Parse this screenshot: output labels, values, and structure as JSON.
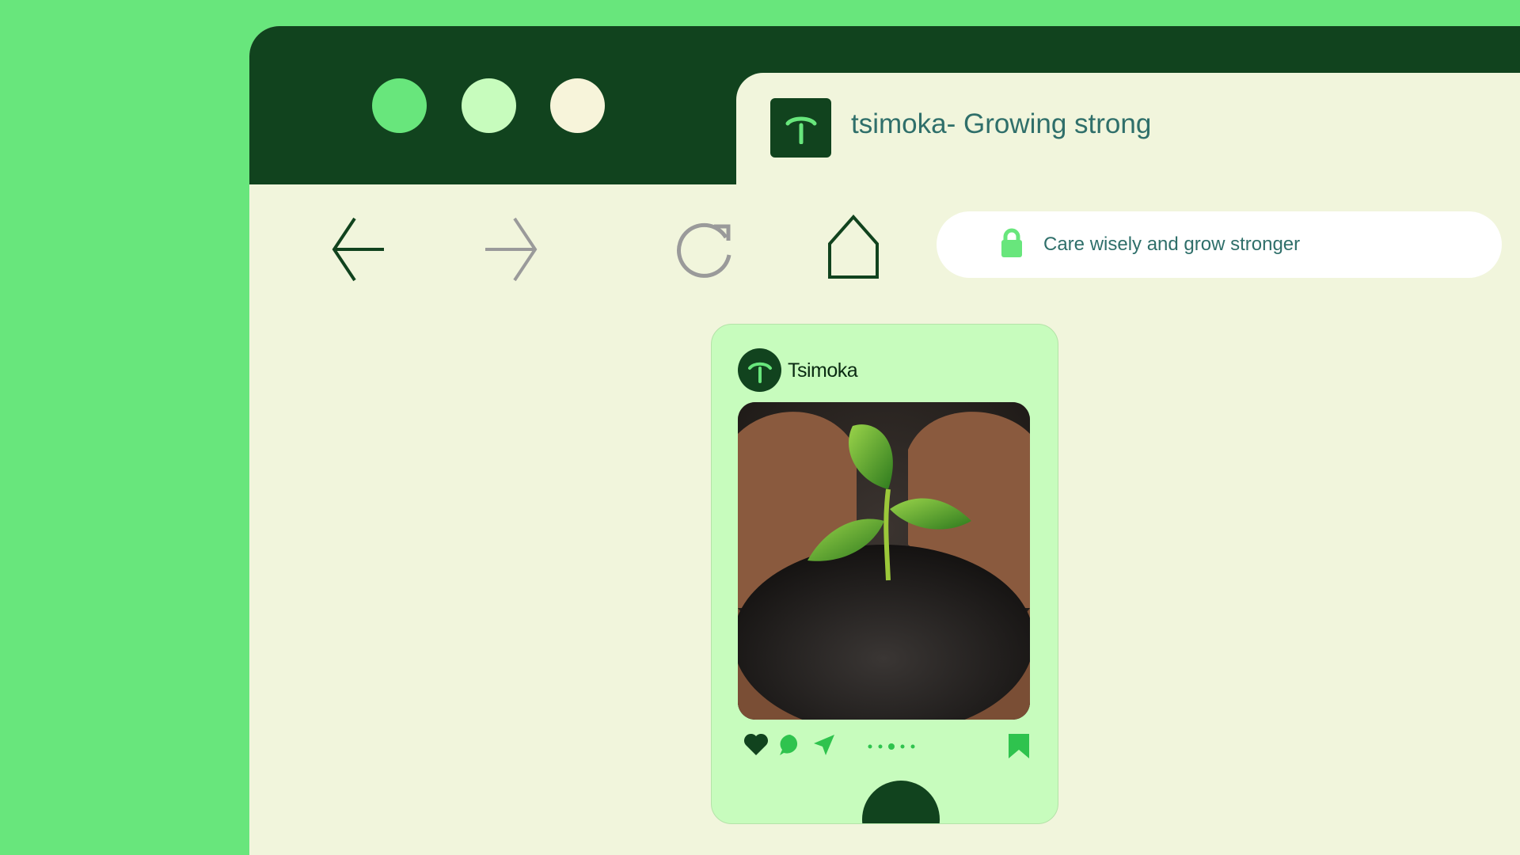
{
  "window": {
    "controls": [
      "window-dot-1",
      "window-dot-2",
      "window-dot-3"
    ],
    "colors": {
      "dot1": "#68e67c",
      "dot2": "#c7fcbd",
      "dot3": "#f7f4da",
      "frame": "#11431e"
    }
  },
  "tab": {
    "title": "tsimoka- Growing strong",
    "icon": "sprout-logo-icon"
  },
  "toolbar": {
    "back_icon": "arrow-left-icon",
    "forward_icon": "arrow-right-icon",
    "reload_icon": "reload-icon",
    "home_icon": "home-icon"
  },
  "addressbar": {
    "icon": "lock-icon",
    "text": "Care wisely and grow stronger"
  },
  "post": {
    "account_name": "Tsimoka",
    "image_description_icon": "seedling-in-soil-photo",
    "actions": [
      "heart-icon",
      "comment-icon",
      "send-icon",
      "more-dots-icon",
      "bookmark-icon"
    ],
    "accent": "#68e67c",
    "dark": "#11431e"
  }
}
